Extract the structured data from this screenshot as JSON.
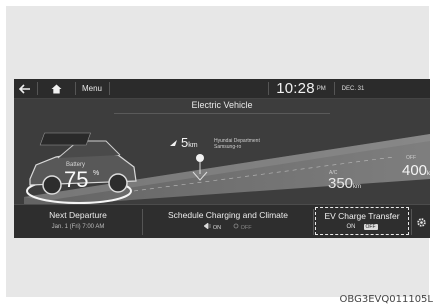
{
  "statusbar": {
    "menu_label": "Menu",
    "clock": "10:28",
    "ampm": "PM",
    "date": "DEC. 31"
  },
  "screen_title": "Electric Vehicle",
  "battery": {
    "label": "Battery",
    "value": "75",
    "unit": "%"
  },
  "poi": {
    "distance": "5",
    "unit": "km",
    "name_line1": "Hyundai Department",
    "name_line2": "Samsung-ro"
  },
  "range_ac": {
    "tag": "A/C",
    "value": "350",
    "unit": "km"
  },
  "range_off": {
    "tag": "OFF",
    "value": "400",
    "unit": "km"
  },
  "bottom": {
    "next_departure_title": "Next Departure",
    "next_departure_sub": "Jan. 1 (Fri) 7:00 AM",
    "schedule_title": "Schedule Charging and Climate",
    "schedule_on": "ON",
    "schedule_off": "OFF",
    "ev_transfer_title": "EV Charge Transfer",
    "ev_transfer_on": "ON",
    "ev_transfer_off": "OFF"
  },
  "watermark": "OBG3EVQ011105L",
  "icons": [
    "back-arrow-icon",
    "home-icon",
    "car-icon",
    "destination-pin-icon",
    "plug-icon",
    "climate-icon",
    "gear-icon"
  ]
}
